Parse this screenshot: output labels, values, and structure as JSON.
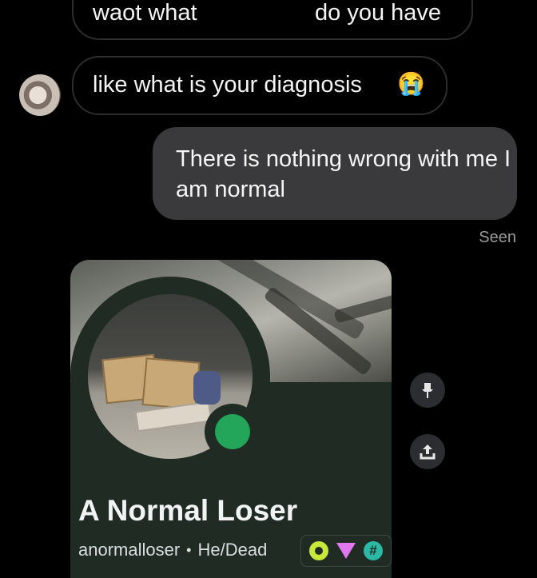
{
  "messages": {
    "top_bubble": {
      "left_text": "waot what",
      "right_text": "do you have"
    },
    "received": {
      "text": "like what is your diagnosis",
      "emoji": "😭"
    },
    "sent": {
      "text": "There is nothing wrong with me I am normal"
    },
    "status": "Seen"
  },
  "profile_card": {
    "display_name": "A Normal Loser",
    "username": "anormalloser",
    "separator": "•",
    "pronouns": "He/Dead",
    "status_color": "#23a55a",
    "badges": [
      "nitro-badge-icon",
      "gem-badge-icon",
      "hashtag-badge-icon"
    ],
    "badge_hash": "#"
  },
  "side_actions": [
    "pin-icon",
    "share-icon"
  ]
}
